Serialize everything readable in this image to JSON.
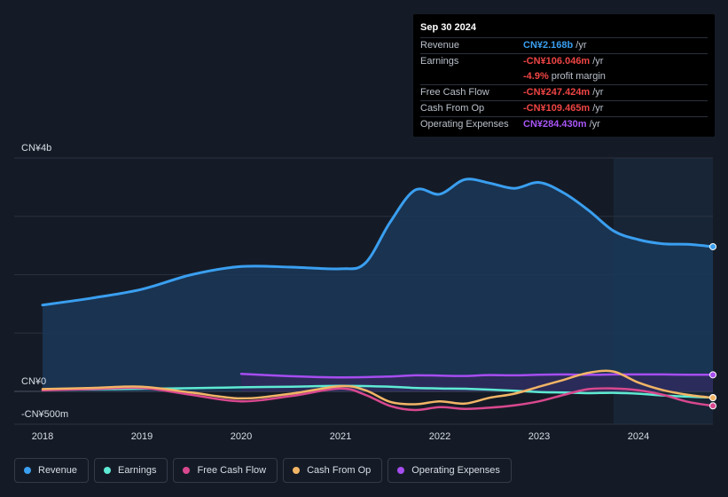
{
  "tooltip": {
    "date": "Sep 30 2024",
    "rows": [
      {
        "label": "Revenue",
        "value": "CN¥2.168b",
        "unit": "/yr",
        "color": "#3a9ff0"
      },
      {
        "label": "Earnings",
        "value": "-CN¥106.046m",
        "unit": "/yr",
        "color": "#ef4444"
      },
      {
        "label": "",
        "value": "-4.9%",
        "unit": "profit margin",
        "color": "#ef4444"
      },
      {
        "label": "Free Cash Flow",
        "value": "-CN¥247.424m",
        "unit": "/yr",
        "color": "#ef4444"
      },
      {
        "label": "Cash From Op",
        "value": "-CN¥109.465m",
        "unit": "/yr",
        "color": "#ef4444"
      },
      {
        "label": "Operating Expenses",
        "value": "CN¥284.430m",
        "unit": "/yr",
        "color": "#a855f7"
      }
    ]
  },
  "legend": [
    {
      "label": "Revenue",
      "color": "#3a9ff0"
    },
    {
      "label": "Earnings",
      "color": "#5eead4"
    },
    {
      "label": "Free Cash Flow",
      "color": "#d9488f"
    },
    {
      "label": "Cash From Op",
      "color": "#f2b566"
    },
    {
      "label": "Operating Expenses",
      "color": "#a64df0"
    }
  ],
  "chart_data": {
    "type": "area",
    "y_top_label": "CN¥4b",
    "y_zero_label": "CN¥0",
    "y_bottom_label": "-CN¥500m",
    "ylim": [
      -500,
      4000
    ],
    "xlim": [
      2018,
      2024.75
    ],
    "x_ticks": [
      "2018",
      "2019",
      "2020",
      "2021",
      "2022",
      "2023",
      "2024"
    ],
    "x_tick_values": [
      2018,
      2019,
      2020,
      2021,
      2022,
      2023,
      2024
    ],
    "forecast_start": 2023.75,
    "series": [
      {
        "name": "Revenue",
        "color": "#3a9ff0",
        "fill": true,
        "points": [
          [
            2018,
            1480
          ],
          [
            2018.5,
            1600
          ],
          [
            2019,
            1750
          ],
          [
            2019.5,
            2000
          ],
          [
            2020,
            2140
          ],
          [
            2020.5,
            2130
          ],
          [
            2021,
            2100
          ],
          [
            2021.25,
            2200
          ],
          [
            2021.5,
            2900
          ],
          [
            2021.75,
            3450
          ],
          [
            2022,
            3380
          ],
          [
            2022.25,
            3630
          ],
          [
            2022.5,
            3570
          ],
          [
            2022.75,
            3480
          ],
          [
            2023,
            3580
          ],
          [
            2023.25,
            3400
          ],
          [
            2023.5,
            3100
          ],
          [
            2023.75,
            2750
          ],
          [
            2024,
            2600
          ],
          [
            2024.25,
            2530
          ],
          [
            2024.5,
            2520
          ],
          [
            2024.75,
            2480
          ]
        ]
      },
      {
        "name": "Earnings",
        "color": "#5eead4",
        "fill": false,
        "points": [
          [
            2018,
            30
          ],
          [
            2018.5,
            35
          ],
          [
            2019,
            45
          ],
          [
            2019.5,
            55
          ],
          [
            2020,
            70
          ],
          [
            2020.5,
            80
          ],
          [
            2021,
            95
          ],
          [
            2021.5,
            80
          ],
          [
            2021.75,
            60
          ],
          [
            2022,
            50
          ],
          [
            2022.25,
            45
          ],
          [
            2022.5,
            30
          ],
          [
            2022.75,
            10
          ],
          [
            2023,
            -10
          ],
          [
            2023.25,
            -20
          ],
          [
            2023.5,
            -30
          ],
          [
            2023.75,
            -25
          ],
          [
            2024,
            -40
          ],
          [
            2024.25,
            -70
          ],
          [
            2024.5,
            -90
          ],
          [
            2024.75,
            -106
          ]
        ]
      },
      {
        "name": "Free Cash Flow",
        "color": "#d9488f",
        "fill": false,
        "points": [
          [
            2018,
            20
          ],
          [
            2018.5,
            40
          ],
          [
            2019,
            60
          ],
          [
            2019.5,
            -60
          ],
          [
            2020,
            -170
          ],
          [
            2020.5,
            -80
          ],
          [
            2021,
            50
          ],
          [
            2021.25,
            -60
          ],
          [
            2021.5,
            -250
          ],
          [
            2021.75,
            -320
          ],
          [
            2022,
            -270
          ],
          [
            2022.25,
            -300
          ],
          [
            2022.5,
            -280
          ],
          [
            2022.75,
            -240
          ],
          [
            2023,
            -170
          ],
          [
            2023.25,
            -60
          ],
          [
            2023.5,
            40
          ],
          [
            2023.75,
            50
          ],
          [
            2024,
            20
          ],
          [
            2024.25,
            -60
          ],
          [
            2024.5,
            -180
          ],
          [
            2024.75,
            -247
          ]
        ]
      },
      {
        "name": "Cash From Op",
        "color": "#f2b566",
        "fill": false,
        "points": [
          [
            2018,
            40
          ],
          [
            2018.5,
            60
          ],
          [
            2019,
            80
          ],
          [
            2019.5,
            -20
          ],
          [
            2020,
            -120
          ],
          [
            2020.5,
            -40
          ],
          [
            2021,
            90
          ],
          [
            2021.25,
            20
          ],
          [
            2021.5,
            -180
          ],
          [
            2021.75,
            -220
          ],
          [
            2022,
            -170
          ],
          [
            2022.25,
            -210
          ],
          [
            2022.5,
            -110
          ],
          [
            2022.75,
            -40
          ],
          [
            2023,
            80
          ],
          [
            2023.25,
            200
          ],
          [
            2023.5,
            320
          ],
          [
            2023.75,
            340
          ],
          [
            2024,
            150
          ],
          [
            2024.25,
            20
          ],
          [
            2024.5,
            -60
          ],
          [
            2024.75,
            -109
          ]
        ]
      },
      {
        "name": "Operating Expenses",
        "color": "#a64df0",
        "fill": true,
        "points": [
          [
            2020,
            300
          ],
          [
            2020.5,
            260
          ],
          [
            2021,
            240
          ],
          [
            2021.5,
            255
          ],
          [
            2021.75,
            275
          ],
          [
            2022,
            270
          ],
          [
            2022.25,
            265
          ],
          [
            2022.5,
            280
          ],
          [
            2022.75,
            275
          ],
          [
            2023,
            285
          ],
          [
            2023.25,
            290
          ],
          [
            2023.5,
            285
          ],
          [
            2023.75,
            290
          ],
          [
            2024,
            290
          ],
          [
            2024.25,
            290
          ],
          [
            2024.5,
            285
          ],
          [
            2024.75,
            284
          ]
        ]
      }
    ]
  }
}
